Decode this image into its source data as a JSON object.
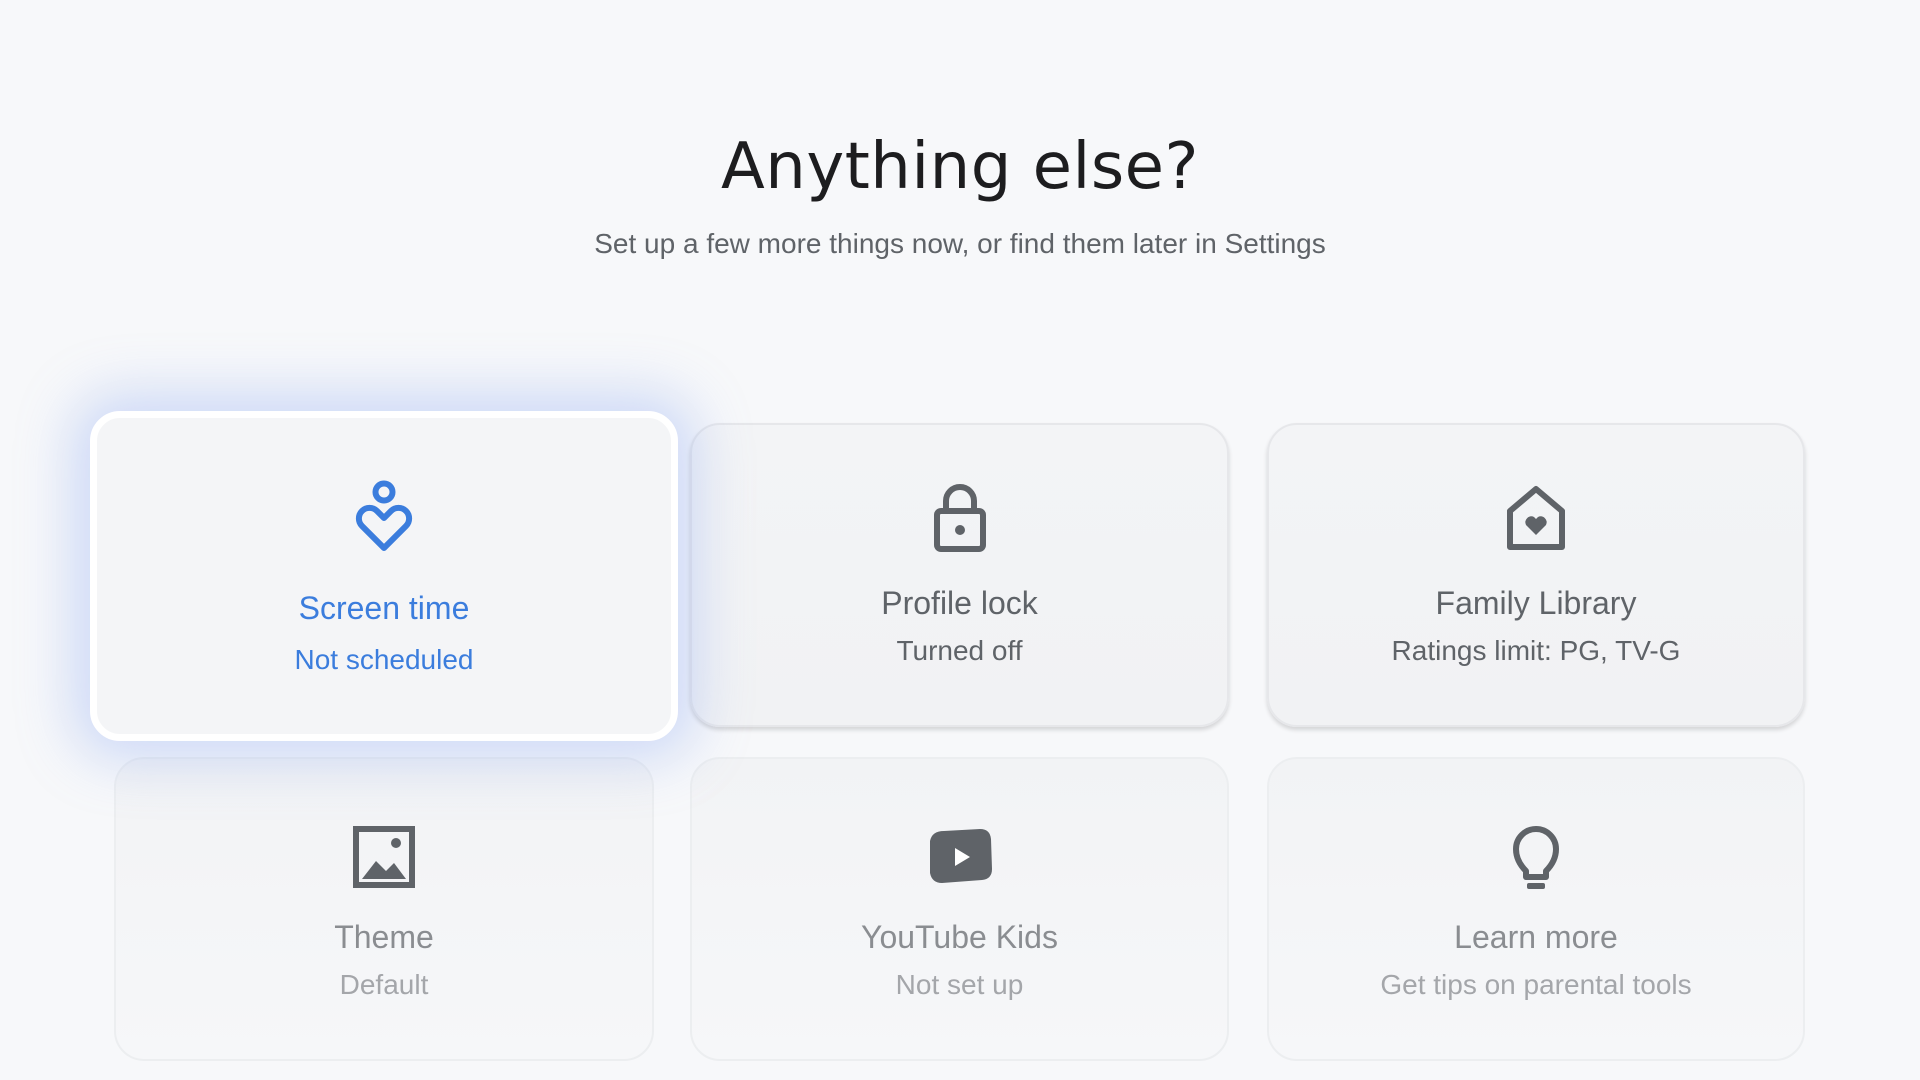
{
  "header": {
    "title": "Anything else?",
    "subtitle": "Set up a few more things now, or find them later in Settings"
  },
  "colors": {
    "focus_accent": "#3b7ddd",
    "icon_gray": "#5f6368",
    "background": "#f7f8fa"
  },
  "cards": [
    {
      "label": "Screen time",
      "status": "Not scheduled",
      "icon": "screen-time-icon",
      "focused": true
    },
    {
      "label": "Profile lock",
      "status": "Turned off",
      "icon": "lock-icon"
    },
    {
      "label": "Family Library",
      "status": "Ratings limit: PG, TV-G",
      "icon": "home-heart-icon"
    },
    {
      "label": "Theme",
      "status": "Default",
      "icon": "image-icon"
    },
    {
      "label": "YouTube Kids",
      "status": "Not set up",
      "icon": "youtube-icon"
    },
    {
      "label": "Learn more",
      "status": "Get tips on parental tools",
      "icon": "lightbulb-icon"
    }
  ]
}
